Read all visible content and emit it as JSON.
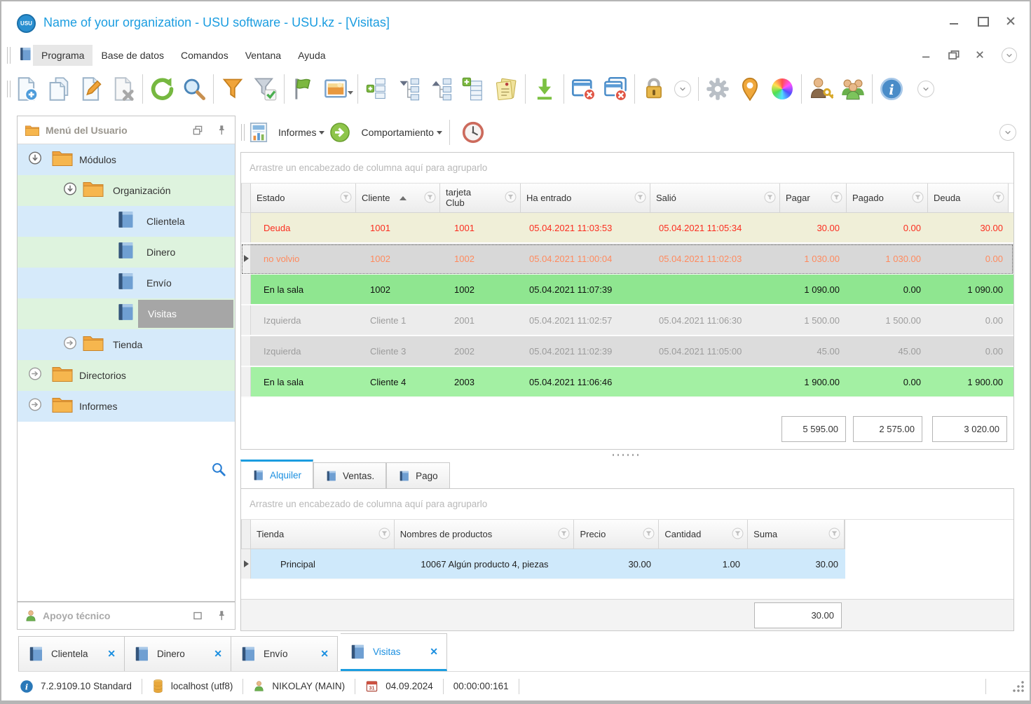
{
  "window": {
    "logo_text": "USU",
    "title": "Name of your organization - USU software - USU.kz - [Visitas]"
  },
  "menu": {
    "items": [
      "Programa",
      "Base de datos",
      "Comandos",
      "Ventana",
      "Ayuda"
    ]
  },
  "toolbar_icons": [
    "new-document",
    "copy-document",
    "edit-document",
    "delete-document",
    "refresh",
    "search",
    "filter",
    "filter-apply",
    "flag",
    "image",
    "expand-levels",
    "collapse-tree",
    "expand-tree",
    "add-row",
    "notes",
    "export-download",
    "close-window",
    "close-all-windows",
    "lock",
    "overflow-chevron",
    "settings-gear",
    "location-pin",
    "color-scheme",
    "user-permissions",
    "users-group",
    "info",
    "overflow-chevron"
  ],
  "colors": {
    "accent_blue": "#1b9de0",
    "row_debt_bg": "#f0efd8",
    "row_debt_text": "#fb2d1f",
    "row_focused_bg": "#d8d8d8",
    "row_focused_text": "#ff8a5e",
    "row_inhall_bg": "#8fe690",
    "row_left_text": "#9c9c9c",
    "tree_blue": "#d6eafa",
    "tree_green": "#def3de",
    "selected_node": "#a6a6a6"
  },
  "sidebar": {
    "title": "Menú del Usuario",
    "tree": [
      "Módulos",
      "Organización",
      "Clientela",
      "Dinero",
      "Envío",
      "Visitas",
      "Tienda",
      "Directorios",
      "Informes"
    ],
    "support_title": "Apoyo técnico"
  },
  "view_toolbar": {
    "reports_label": "Informes",
    "behavior_label": "Comportamiento"
  },
  "main_grid": {
    "group_hint": "Arrastre un encabezado de columna aquí para agruparlo",
    "columns": {
      "estado": "Estado",
      "cliente": "Cliente",
      "tarjeta": "tarjeta Club",
      "entrado": "Ha entrado",
      "salio": "Salió",
      "pagar": "Pagar",
      "pagado": "Pagado",
      "deuda": "Deuda"
    },
    "rows": [
      {
        "estado": "Deuda",
        "cliente": "1001",
        "tarjeta": "1001",
        "entrado": "05.04.2021 11:03:53",
        "salio": "05.04.2021 11:05:34",
        "pagar": "30.00",
        "pagado": "0.00",
        "deuda": "30.00"
      },
      {
        "estado": "no volvio",
        "cliente": "1002",
        "tarjeta": "1002",
        "entrado": "05.04.2021 11:00:04",
        "salio": "05.04.2021 11:02:03",
        "pagar": "1 030.00",
        "pagado": "1 030.00",
        "deuda": "0.00"
      },
      {
        "estado": "En la sala",
        "cliente": "1002",
        "tarjeta": "1002",
        "entrado": "05.04.2021 11:07:39",
        "salio": "",
        "pagar": "1 090.00",
        "pagado": "0.00",
        "deuda": "1 090.00"
      },
      {
        "estado": "Izquierda",
        "cliente": "Cliente 1",
        "tarjeta": "2001",
        "entrado": "05.04.2021 11:02:57",
        "salio": "05.04.2021 11:06:30",
        "pagar": "1 500.00",
        "pagado": "1 500.00",
        "deuda": "0.00"
      },
      {
        "estado": "Izquierda",
        "cliente": "Cliente 3",
        "tarjeta": "2002",
        "entrado": "05.04.2021 11:02:39",
        "salio": "05.04.2021 11:05:00",
        "pagar": "45.00",
        "pagado": "45.00",
        "deuda": "0.00"
      },
      {
        "estado": "En la sala",
        "cliente": "Cliente 4",
        "tarjeta": "2003",
        "entrado": "05.04.2021 11:06:46",
        "salio": "",
        "pagar": "1 900.00",
        "pagado": "0.00",
        "deuda": "1 900.00"
      }
    ],
    "totals": {
      "pagar": "5 595.00",
      "pagado": "2 575.00",
      "deuda": "3 020.00"
    }
  },
  "detail_tabs": [
    "Alquiler",
    "Ventas.",
    "Pago"
  ],
  "detail_grid": {
    "group_hint": "Arrastre un encabezado de columna aquí para agruparlo",
    "columns": {
      "tienda": "Tienda",
      "nombres": "Nombres de productos",
      "precio": "Precio",
      "cantidad": "Cantidad",
      "suma": "Suma"
    },
    "rows": [
      {
        "tienda": "Principal",
        "nombres": "10067 Algún producto 4, piezas",
        "precio": "30.00",
        "cantidad": "1.00",
        "suma": "30.00"
      }
    ],
    "total_suma": "30.00"
  },
  "bottom_tabs": [
    "Clientela",
    "Dinero",
    "Envío",
    "Visitas"
  ],
  "status_bar": {
    "version": "7.2.9109.10 Standard",
    "host": "localhost (utf8)",
    "user": "NIKOLAY (MAIN)",
    "calendar_day": "31",
    "date": "04.09.2024",
    "time": "00:00:00:161",
    "info_glyph": "i"
  },
  "tab_close_glyph": "✕"
}
